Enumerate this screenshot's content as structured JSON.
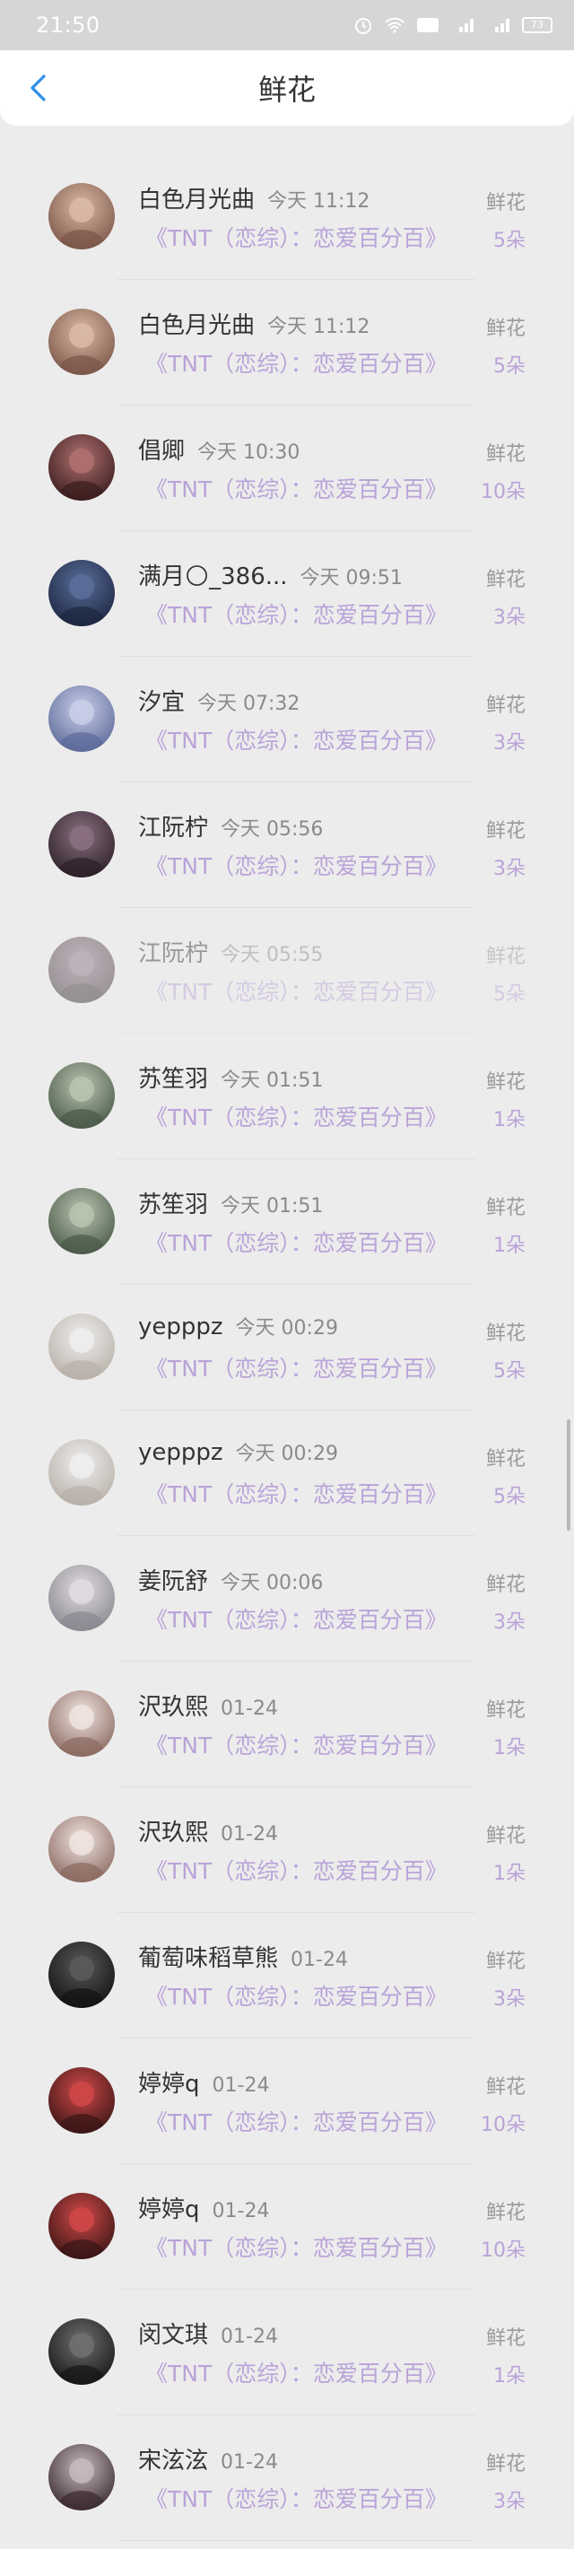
{
  "status_bar": {
    "time": "21:50",
    "battery": "73"
  },
  "header": {
    "title": "鲜花"
  },
  "rows": [
    {
      "name": "白色月光曲",
      "time": "今天 11:12",
      "topic": "《TNT（恋综）：恋爱百分百》",
      "type": "鲜花",
      "count": "5朵",
      "avatar": [
        "#d9b8a4",
        "#7a5648"
      ],
      "faded": false
    },
    {
      "name": "白色月光曲",
      "time": "今天 11:12",
      "topic": "《TNT（恋综）：恋爱百分百》",
      "type": "鲜花",
      "count": "5朵",
      "avatar": [
        "#d9b8a4",
        "#7a5648"
      ],
      "faded": false
    },
    {
      "name": "倡卿",
      "time": "今天 10:30",
      "topic": "《TNT（恋综）：恋爱百分百》",
      "type": "鲜花",
      "count": "10朵",
      "avatar": [
        "#b07070",
        "#3a1d1d"
      ],
      "faded": false
    },
    {
      "name": "满月🌕_386...",
      "time": "今天 09:51",
      "topic": "《TNT（恋综）：恋爱百分百》",
      "type": "鲜花",
      "count": "3朵",
      "avatar": [
        "#5a6e9a",
        "#1c2640"
      ],
      "faded": false
    },
    {
      "name": "汐宜",
      "time": "今天 07:32",
      "topic": "《TNT（恋综）：恋爱百分百》",
      "type": "鲜花",
      "count": "3朵",
      "avatar": [
        "#c9cfe8",
        "#5c6a9a"
      ],
      "faded": false
    },
    {
      "name": "江阮柠",
      "time": "今天 05:56",
      "topic": "《TNT（恋综）：恋爱百分百》",
      "type": "鲜花",
      "count": "3朵",
      "avatar": [
        "#8a7080",
        "#2c2028"
      ],
      "faded": false
    },
    {
      "name": "江阮柠",
      "time": "今天 05:55",
      "topic": "《TNT（恋综）：恋爱百分百》",
      "type": "鲜花",
      "count": "5朵",
      "avatar": [
        "#8a7080",
        "#2c2028"
      ],
      "faded": true
    },
    {
      "name": "苏笙羽",
      "time": "今天 01:51",
      "topic": "《TNT（恋综）：恋爱百分百》",
      "type": "鲜花",
      "count": "1朵",
      "avatar": [
        "#b8c4b0",
        "#4a5a48"
      ],
      "faded": false
    },
    {
      "name": "苏笙羽",
      "time": "今天 01:51",
      "topic": "《TNT（恋综）：恋爱百分百》",
      "type": "鲜花",
      "count": "1朵",
      "avatar": [
        "#b8c4b0",
        "#4a5a48"
      ],
      "faded": false
    },
    {
      "name": "yepppz",
      "time": "今天 00:29",
      "topic": "《TNT（恋综）：恋爱百分百》",
      "type": "鲜花",
      "count": "5朵",
      "avatar": [
        "#eeeeee",
        "#b8b0a8"
      ],
      "faded": false
    },
    {
      "name": "yepppz",
      "time": "今天 00:29",
      "topic": "《TNT（恋综）：恋爱百分百》",
      "type": "鲜花",
      "count": "5朵",
      "avatar": [
        "#eeeeee",
        "#b8b0a8"
      ],
      "faded": false
    },
    {
      "name": "姜阮舒",
      "time": "今天 00:06",
      "topic": "《TNT（恋综）：恋爱百分百》",
      "type": "鲜花",
      "count": "3朵",
      "avatar": [
        "#e0dce0",
        "#8a8890"
      ],
      "faded": false
    },
    {
      "name": "沢玖熙",
      "time": "01-24",
      "topic": "《TNT（恋综）：恋爱百分百》",
      "type": "鲜花",
      "count": "1朵",
      "avatar": [
        "#f0e4e0",
        "#8a6a60"
      ],
      "faded": false
    },
    {
      "name": "沢玖熙",
      "time": "01-24",
      "topic": "《TNT（恋综）：恋爱百分百》",
      "type": "鲜花",
      "count": "1朵",
      "avatar": [
        "#f0e4e0",
        "#8a6a60"
      ],
      "faded": false
    },
    {
      "name": "葡萄味稻草熊",
      "time": "01-24",
      "topic": "《TNT（恋综）：恋爱百分百》",
      "type": "鲜花",
      "count": "3朵",
      "avatar": [
        "#5a5a5a",
        "#121212"
      ],
      "faded": false
    },
    {
      "name": "婷婷q",
      "time": "01-24",
      "topic": "《TNT（恋综）：恋爱百分百》",
      "type": "鲜花",
      "count": "10朵",
      "avatar": [
        "#d04848",
        "#3a1616"
      ],
      "faded": false
    },
    {
      "name": "婷婷q",
      "time": "01-24",
      "topic": "《TNT（恋综）：恋爱百分百》",
      "type": "鲜花",
      "count": "10朵",
      "avatar": [
        "#d04848",
        "#3a1616"
      ],
      "faded": false
    },
    {
      "name": "闵文琪",
      "time": "01-24",
      "topic": "《TNT（恋综）：恋爱百分百》",
      "type": "鲜花",
      "count": "1朵",
      "avatar": [
        "#707070",
        "#161616"
      ],
      "faded": false
    },
    {
      "name": "宋泫泫",
      "time": "01-24",
      "topic": "《TNT（恋综）：恋爱百分百》",
      "type": "鲜花",
      "count": "3朵",
      "avatar": [
        "#c8b8c0",
        "#3a2a30"
      ],
      "faded": false
    }
  ]
}
